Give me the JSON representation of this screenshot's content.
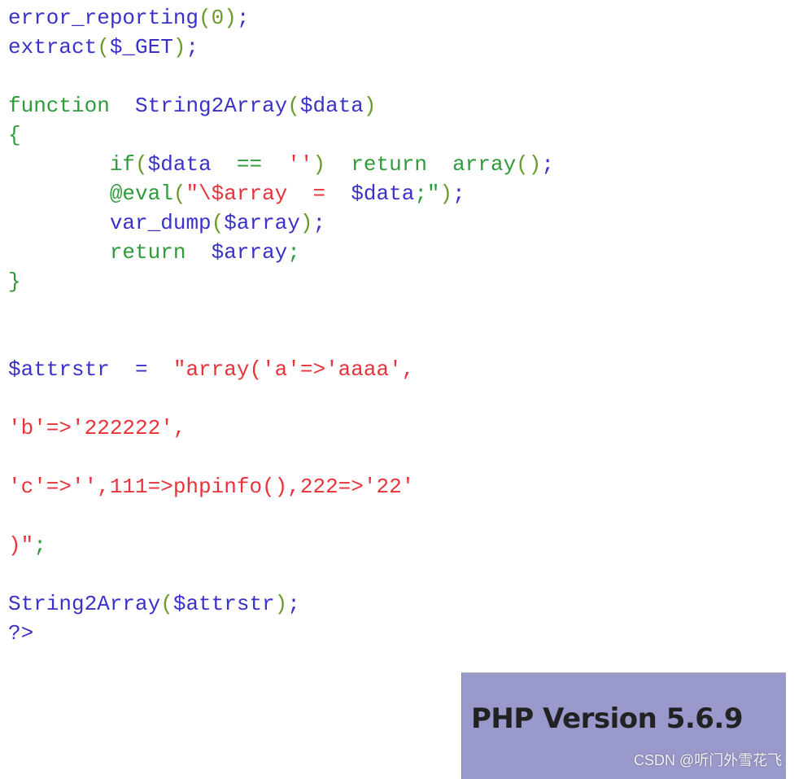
{
  "code_lines": [
    [
      [
        "error_reporting",
        "fn"
      ],
      [
        "(0)",
        "p"
      ],
      [
        ";",
        "fn"
      ]
    ],
    [
      [
        "extract",
        "fn"
      ],
      [
        "(",
        "p"
      ],
      [
        "$_GET",
        "var"
      ],
      [
        ")",
        "p"
      ],
      [
        ";",
        "fn"
      ]
    ],
    [],
    [
      [
        "function",
        "kw"
      ],
      [
        "  ",
        "kw"
      ],
      [
        "String2Array",
        "fn"
      ],
      [
        "(",
        "p"
      ],
      [
        "$data",
        "var"
      ],
      [
        ")",
        "p"
      ]
    ],
    [
      [
        "{",
        "kw"
      ]
    ],
    [
      [
        "        ",
        "kw"
      ],
      [
        "if",
        "kw"
      ],
      [
        "(",
        "p"
      ],
      [
        "$data",
        "var"
      ],
      [
        "  ==  ",
        "kw"
      ],
      [
        "''",
        "str"
      ],
      [
        ")",
        "p"
      ],
      [
        "  return  ",
        "kw"
      ],
      [
        "array",
        "kw"
      ],
      [
        "()",
        "p"
      ],
      [
        ";",
        "fn"
      ]
    ],
    [
      [
        "        ",
        "kw"
      ],
      [
        "@eval",
        "kw"
      ],
      [
        "(",
        "p"
      ],
      [
        "\"\\",
        "str"
      ],
      [
        "$array",
        "str"
      ],
      [
        "  =  ",
        "str"
      ],
      [
        "$data",
        "var"
      ],
      [
        ";\"",
        "kw"
      ],
      [
        ")",
        "p"
      ],
      [
        ";",
        "fn"
      ]
    ],
    [
      [
        "        ",
        "kw"
      ],
      [
        "var_dump",
        "fn"
      ],
      [
        "(",
        "p"
      ],
      [
        "$array",
        "var"
      ],
      [
        ")",
        "p"
      ],
      [
        ";",
        "fn"
      ]
    ],
    [
      [
        "        ",
        "kw"
      ],
      [
        "return",
        "kw"
      ],
      [
        "  ",
        "kw"
      ],
      [
        "$array",
        "var"
      ],
      [
        ";",
        "kw"
      ]
    ],
    [
      [
        "}",
        "kw"
      ]
    ],
    [],
    [],
    [
      [
        "$attrstr",
        "var"
      ],
      [
        "  =  ",
        "var"
      ],
      [
        "\"array('a'=>'aaaa',",
        "str"
      ]
    ],
    [],
    [
      [
        "'b'=>'222222',",
        "str"
      ]
    ],
    [],
    [
      [
        "'c'=>'',111=>phpinfo(),222=>'22'",
        "str"
      ]
    ],
    [],
    [
      [
        ")\"",
        "str"
      ],
      [
        ";",
        "kw"
      ]
    ],
    [],
    [
      [
        "String2Array",
        "fn"
      ],
      [
        "(",
        "p"
      ],
      [
        "$attrstr",
        "var"
      ],
      [
        ")",
        "p"
      ],
      [
        ";",
        "fn"
      ]
    ],
    [
      [
        "?>",
        "fn"
      ]
    ]
  ],
  "phpinfo": {
    "title": "PHP Version 5.6.9",
    "header_color": "#9999cc"
  },
  "watermark": "CSDN @听门外雪花飞",
  "colors": {
    "function": "#3a32c8",
    "keyword": "#2f9a3a",
    "string": "#e8333a"
  }
}
